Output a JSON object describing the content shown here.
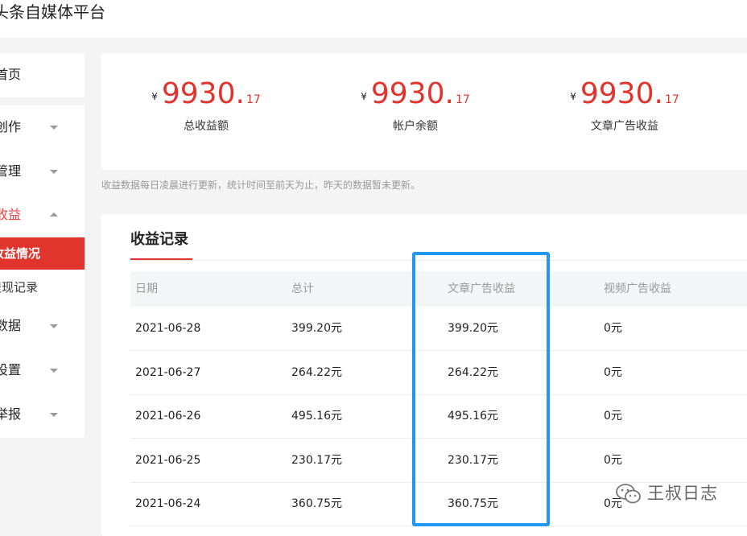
{
  "app": {
    "title": "头条自媒体平台"
  },
  "sidebar": {
    "home_label": "首页",
    "items": [
      {
        "label": "创作",
        "expanded": false
      },
      {
        "label": "管理",
        "expanded": false
      },
      {
        "label": "收益",
        "expanded": true,
        "children": [
          {
            "label": "收益情况",
            "selected": true
          },
          {
            "label": "提现记录",
            "selected": false
          }
        ]
      },
      {
        "label": "数据",
        "expanded": false
      },
      {
        "label": "设置",
        "expanded": false
      },
      {
        "label": "举报",
        "expanded": false
      }
    ]
  },
  "summary": {
    "currency_symbol": "¥",
    "stats": [
      {
        "integer": "9930",
        "decimal": "17",
        "caption": "总收益额"
      },
      {
        "integer": "9930",
        "decimal": "17",
        "caption": "帐户余额"
      },
      {
        "integer": "9930",
        "decimal": "17",
        "caption": "文章广告收益"
      }
    ]
  },
  "note": "收益数据每日凌晨进行更新，统计时间至前天为止，昨天的数据暂未更新。",
  "records": {
    "title": "收益记录",
    "columns": [
      "日期",
      "总计",
      "文章广告收益",
      "视频广告收益"
    ],
    "rows": [
      [
        "2021-06-28",
        "399.20元",
        "399.20元",
        "0元"
      ],
      [
        "2021-06-27",
        "264.22元",
        "264.22元",
        "0元"
      ],
      [
        "2021-06-26",
        "495.16元",
        "495.16元",
        "0元"
      ],
      [
        "2021-06-25",
        "230.17元",
        "230.17元",
        "0元"
      ],
      [
        "2021-06-24",
        "360.75元",
        "360.75元",
        "0元"
      ]
    ]
  },
  "watermark": {
    "text": "王叔日志",
    "icon": "wechat-icon"
  },
  "colors": {
    "accent": "#e0342d",
    "highlight": "#2196f3"
  }
}
